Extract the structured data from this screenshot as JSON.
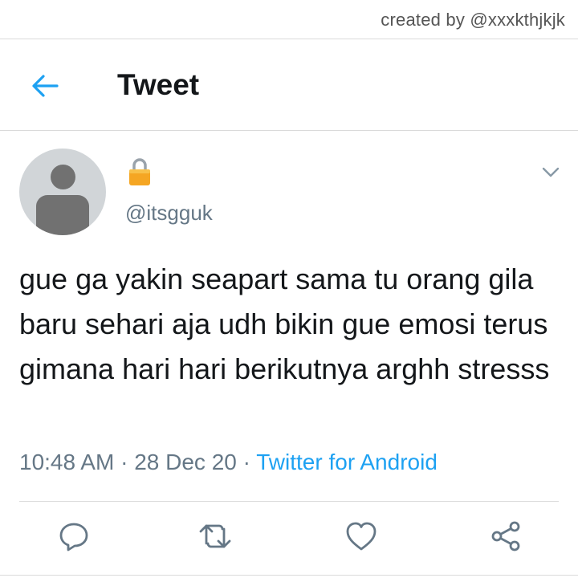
{
  "watermark": "created by @xxxkthjkjk",
  "header": {
    "title": "Tweet",
    "back_icon": "arrow-left-icon"
  },
  "tweet": {
    "author_display_icon": "lock-icon",
    "handle": "@itsgguk",
    "text": "gue ga yakin seapart sama tu orang gila baru sehari aja udh bikin gue emosi terus gimana hari hari berikutnya arghh stresss",
    "time": "10:48 AM",
    "date": "28 Dec 20",
    "separator": "·",
    "source": "Twitter for Android"
  },
  "actions": [
    {
      "name": "reply",
      "icon": "reply-icon"
    },
    {
      "name": "retweet",
      "icon": "retweet-icon"
    },
    {
      "name": "like",
      "icon": "heart-icon"
    },
    {
      "name": "share",
      "icon": "share-icon"
    }
  ],
  "colors": {
    "accent": "#1da1f2",
    "secondary_text": "#657786",
    "primary_text": "#14171a",
    "divider": "#dadada",
    "icon": "#657786"
  }
}
